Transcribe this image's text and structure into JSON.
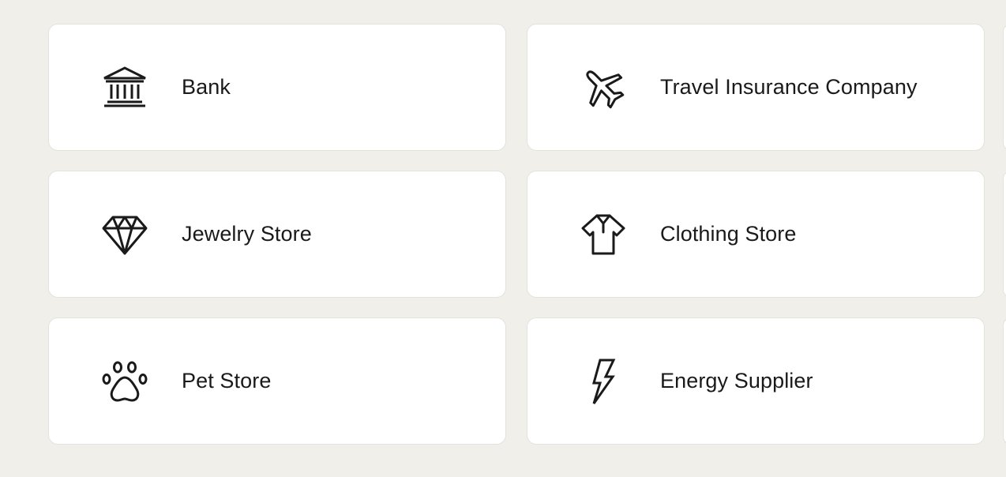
{
  "cards": [
    {
      "label": "Bank",
      "icon": "bank-icon"
    },
    {
      "label": "Travel Insurance Company",
      "icon": "airplane-icon"
    },
    {
      "label": "Jewelry Store",
      "icon": "diamond-icon"
    },
    {
      "label": "Clothing Store",
      "icon": "shirt-icon"
    },
    {
      "label": "Pet Store",
      "icon": "paw-icon"
    },
    {
      "label": "Energy Supplier",
      "icon": "lightning-bolt-icon"
    }
  ],
  "colors": {
    "page_background": "#f0efe9",
    "card_background": "#ffffff",
    "card_border": "#e3e2dc",
    "text": "#1a1a1a",
    "icon_stroke": "#1a1a1a"
  }
}
